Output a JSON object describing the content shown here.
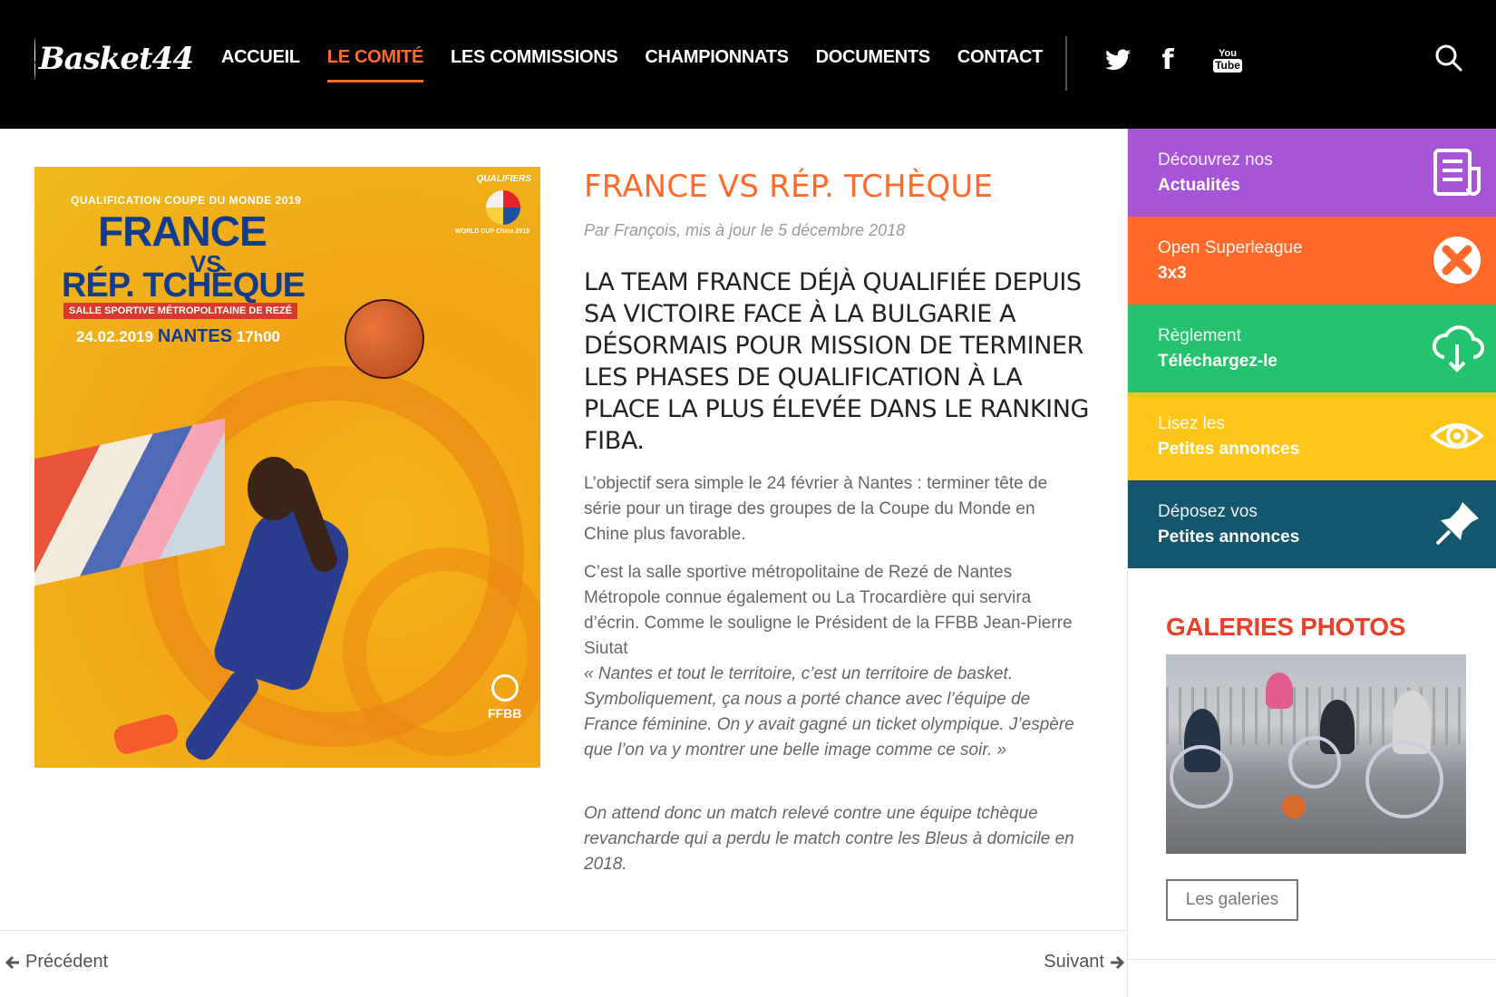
{
  "header": {
    "logo_text": "Basket44",
    "nav": [
      {
        "label": "ACCUEIL",
        "active": false
      },
      {
        "label": "LE COMITÉ",
        "active": true
      },
      {
        "label": "LES COMMISSIONS",
        "active": false
      },
      {
        "label": "CHAMPIONNATS",
        "active": false
      },
      {
        "label": "DOCUMENTS",
        "active": false
      },
      {
        "label": "CONTACT",
        "active": false
      }
    ],
    "social": {
      "facebook_glyph": "f",
      "youtube_top": "You",
      "youtube_bottom": "Tube"
    },
    "accent_color": "#ff6a2b"
  },
  "poster": {
    "qualif": "QUALIFICATION COUPE DU MONDE 2019",
    "team1": "FRANCE",
    "vs": "VS",
    "team2": "RÉP. TCHÈQUE",
    "venue": "SALLE SPORTIVE MÉTROPOLITAINE DE REZÉ",
    "date": "24.02.2019",
    "city": "NANTES",
    "time": "17h00",
    "qualifiers": "QUALIFIERS",
    "worldcup": "WORLD CUP China 2019",
    "ffbb": "FFBB"
  },
  "article": {
    "title": "FRANCE VS RÉP. TCHÈQUE",
    "meta": "Par François, mis à jour le 5 décembre 2018",
    "lead": "La Team France déjà qualifiée depuis sa victoire face à la Bulgarie a désormais pour mission de terminer les phases de qualification à la place la plus élevée dans le ranking FIBA.",
    "p1": "L’objectif sera simple le 24 février à Nantes : terminer tête de série pour un tirage des groupes de la Coupe du Monde en Chine plus favorable.",
    "p2": "C’est la salle sportive métropolitaine de Rezé de Nantes Métropole connue également ou La Trocardière qui servira d’écrin. Comme le souligne le Président de la FFBB Jean-Pierre Siutat",
    "quote": "« Nantes et tout le territoire, c’est un territoire de basket. Symboliquement, ça nous a porté chance avec l’équipe de France féminine. On y avait gagné un ticket olympique. J’espère que l’on va y montrer une belle image comme ce soir. »",
    "p3": "On  attend donc un match relevé contre une équipe tchèque revancharde qui a perdu le match contre les Bleus à domicile en 2018."
  },
  "pager": {
    "prev": "Précédent",
    "next": "Suivant"
  },
  "sidebar": {
    "tiles": [
      {
        "small": "Découvrez nos",
        "big": "Actualités",
        "color": "#a655d6",
        "icon": "newspaper-icon"
      },
      {
        "small": "Open Superleague",
        "big": "3x3",
        "color": "#ff6a2b",
        "icon": "3x3-logo-icon"
      },
      {
        "small": "Règlement",
        "big": "Téléchargez-le",
        "color": "#23c46d",
        "icon": "cloud-download-icon"
      },
      {
        "small": "Lisez les",
        "big": "Petites annonces",
        "color": "#ffc619",
        "icon": "eye-icon"
      },
      {
        "small": "Déposez vos",
        "big": "Petites annonces",
        "color": "#14566e",
        "icon": "pushpin-icon"
      }
    ],
    "gallery": {
      "title": "GALERIES PHOTOS",
      "button": "Les galeries"
    }
  }
}
